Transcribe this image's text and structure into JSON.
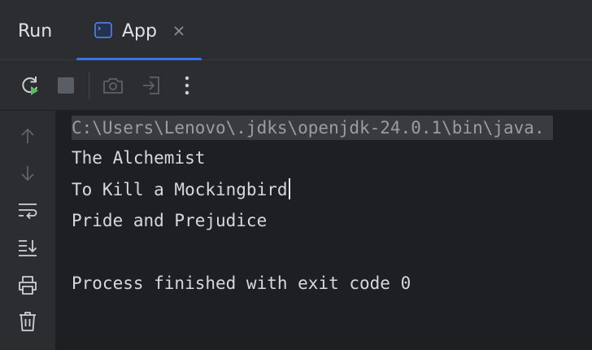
{
  "header": {
    "run_title": "Run",
    "tab": {
      "label": "App",
      "icon": "console-window-icon",
      "close_icon": "close-icon"
    }
  },
  "toolbar": {
    "buttons": [
      {
        "name": "rerun-icon",
        "enabled": true
      },
      {
        "name": "stop-icon",
        "enabled": false
      },
      {
        "name": "camera-icon",
        "enabled": false
      },
      {
        "name": "sign-in-icon",
        "enabled": false
      },
      {
        "name": "more-vertical-icon",
        "enabled": true
      }
    ]
  },
  "gutter": {
    "buttons": [
      {
        "name": "arrow-up-icon",
        "enabled": false
      },
      {
        "name": "arrow-down-icon",
        "enabled": false
      },
      {
        "name": "soft-wrap-icon",
        "enabled": true
      },
      {
        "name": "scroll-to-end-icon",
        "enabled": true
      },
      {
        "name": "print-icon",
        "enabled": true
      },
      {
        "name": "trash-icon",
        "enabled": true
      }
    ]
  },
  "console": {
    "command": "C:\\Users\\Lenovo\\.jdks\\openjdk-24.0.1\\bin\\java.",
    "output_lines": [
      "The Alchemist",
      "To Kill a Mockingbird",
      "Pride and Prejudice",
      "",
      "Process finished with exit code 0"
    ]
  },
  "colors": {
    "background": "#1e1f22",
    "panel": "#2b2d30",
    "accent": "#3574f0",
    "text": "#d6d8dc",
    "rerun_green": "#5fb865"
  }
}
